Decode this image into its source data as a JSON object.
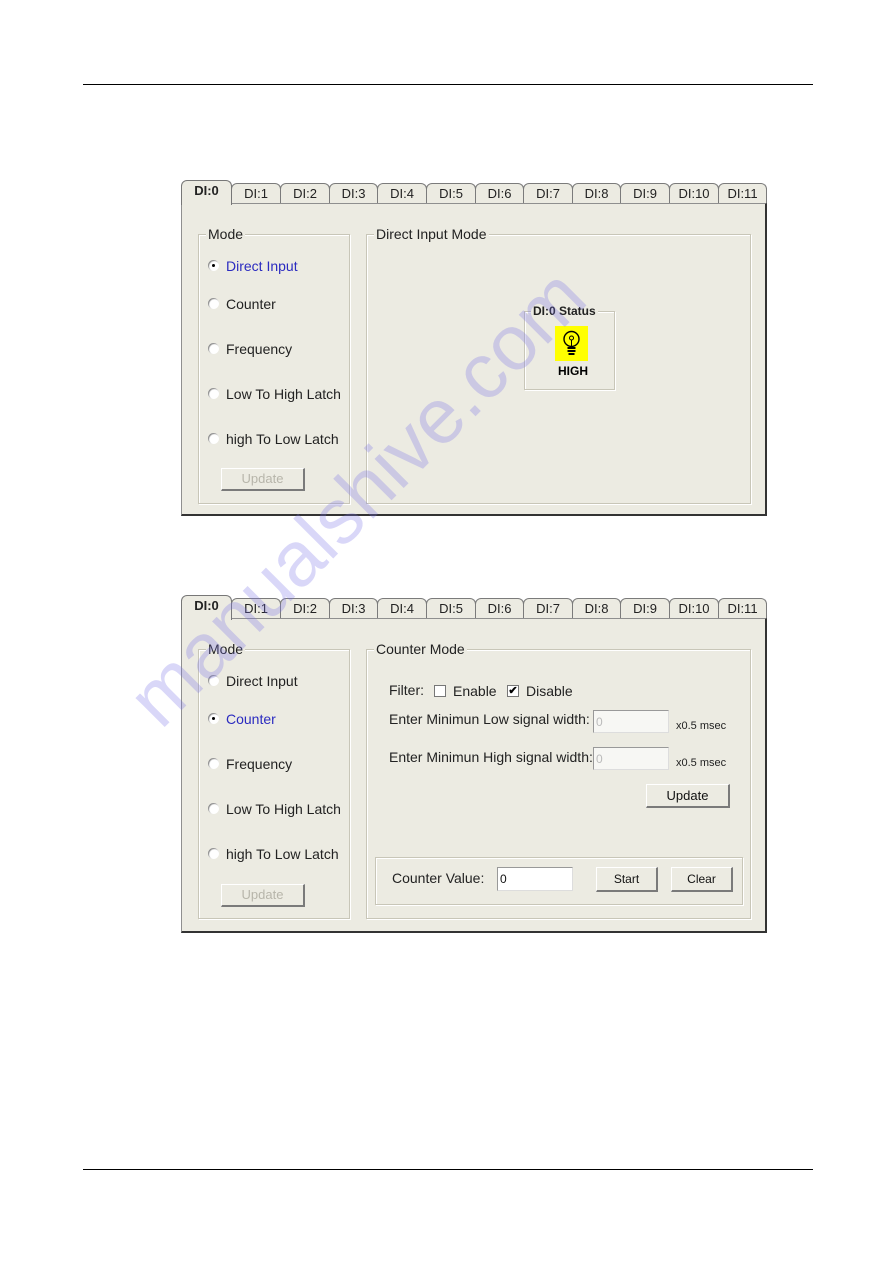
{
  "tabs": [
    "DI:0",
    "DI:1",
    "DI:2",
    "DI:3",
    "DI:4",
    "DI:5",
    "DI:6",
    "DI:7",
    "DI:8",
    "DI:9",
    "DI:10",
    "DI:11"
  ],
  "active_tab": "DI:0",
  "mode_group": {
    "legend": "Mode",
    "options": [
      "Direct Input",
      "Counter",
      "Frequency",
      "Low To High Latch",
      "high To Low Latch"
    ],
    "update_label": "Update"
  },
  "panel1": {
    "selected_mode": "Direct Input",
    "right_legend": "Direct Input Mode",
    "status_legend": "DI:0 Status",
    "status_icon": "lightbulb-icon",
    "status_color": "#ffff00",
    "status_value": "HIGH"
  },
  "panel2": {
    "selected_mode": "Counter",
    "right_legend": "Counter Mode",
    "filter_label": "Filter:",
    "enable_label": "Enable",
    "enable_checked": false,
    "disable_label": "Disable",
    "disable_checked": true,
    "low_width_label": "Enter Minimun Low signal width:",
    "low_width_value": "0",
    "high_width_label": "Enter Minimun High signal width:",
    "high_width_value": "0",
    "unit_label": "x0.5 msec",
    "update_label": "Update",
    "counter_value_label": "Counter Value:",
    "counter_value": "0",
    "start_label": "Start",
    "clear_label": "Clear"
  },
  "watermark": "manualshive.com"
}
